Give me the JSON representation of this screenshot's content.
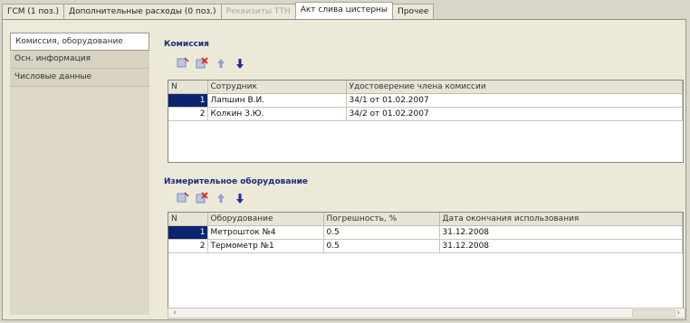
{
  "tabs": [
    {
      "label": "ГСМ (1 поз.)",
      "state": "normal"
    },
    {
      "label": "Дополнительные расходы (0 поз.)",
      "state": "normal"
    },
    {
      "label": "Реквизиты ТТН",
      "state": "disabled"
    },
    {
      "label": "Акт слива цистерны",
      "state": "active"
    },
    {
      "label": "Прочее",
      "state": "normal"
    }
  ],
  "sidebar": {
    "items": [
      {
        "label": "Комиссия, оборудование",
        "selected": true
      },
      {
        "label": "Осн. информация",
        "selected": false
      },
      {
        "label": "Числовые данные",
        "selected": false
      }
    ]
  },
  "commission": {
    "title": "Комиссия",
    "toolbar_icons": [
      "add-icon",
      "delete-icon",
      "move-up-icon",
      "move-down-icon"
    ],
    "columns": [
      "N",
      "Сотрудник",
      "Удостоверение члена комиссии"
    ],
    "rows": [
      {
        "n": "1",
        "employee": "Лапшин В.И.",
        "certificate": "34/1 от 01.02.2007",
        "selected": true
      },
      {
        "n": "2",
        "employee": "Колкин З.Ю.",
        "certificate": "34/2 от 01.02.2007",
        "selected": false
      }
    ]
  },
  "equipment": {
    "title": "Измерительное оборудование",
    "toolbar_icons": [
      "add-icon",
      "delete-icon",
      "move-up-icon",
      "move-down-icon"
    ],
    "columns": [
      "N",
      "Оборудование",
      "Погрешность, %",
      "Дата окончания использования"
    ],
    "rows": [
      {
        "n": "1",
        "equipment": "Метрошток №4",
        "error": "0.5",
        "end_date": "31.12.2008",
        "selected": true
      },
      {
        "n": "2",
        "equipment": "Термометр №1",
        "error": "0.5",
        "end_date": "31.12.2008",
        "selected": false
      }
    ]
  },
  "colors": {
    "accent_title": "#1f2a7a",
    "selection": "#0a2470",
    "arrow": "#1c2f9c"
  }
}
